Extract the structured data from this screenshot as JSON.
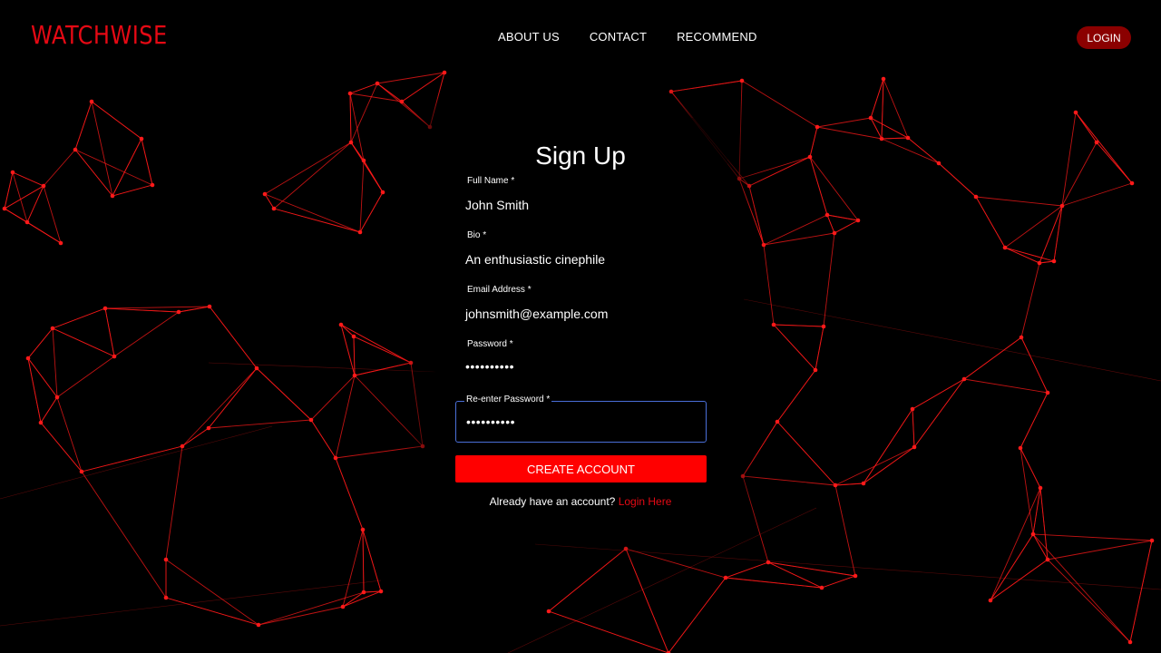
{
  "brand": {
    "name": "WATCHWISE"
  },
  "nav": {
    "items": [
      "ABOUT US",
      "CONTACT",
      "RECOMMEND"
    ]
  },
  "header": {
    "login_label": "LOGIN"
  },
  "form": {
    "title": "Sign Up",
    "fields": [
      {
        "label": "Full Name",
        "required_mark": "*",
        "value": "John Smith"
      },
      {
        "label": "Bio",
        "required_mark": "*",
        "value": "An enthusiastic cinephile"
      },
      {
        "label": "Email Address",
        "required_mark": "*",
        "value": "johnsmith@example.com"
      },
      {
        "label": "Password",
        "required_mark": "*",
        "value": "••••••••••"
      },
      {
        "label": "Re-enter Password",
        "required_mark": "*",
        "value": "••••••••••"
      }
    ],
    "submit_label": "CREATE ACCOUNT",
    "footer_text": "Already have an account?",
    "footer_link": "Login Here"
  },
  "colors": {
    "accent": "#e50914",
    "button": "#ff0000",
    "login_pill": "#8b0000",
    "focus_border": "#4a6fd8",
    "network": "#ff1a1a"
  }
}
